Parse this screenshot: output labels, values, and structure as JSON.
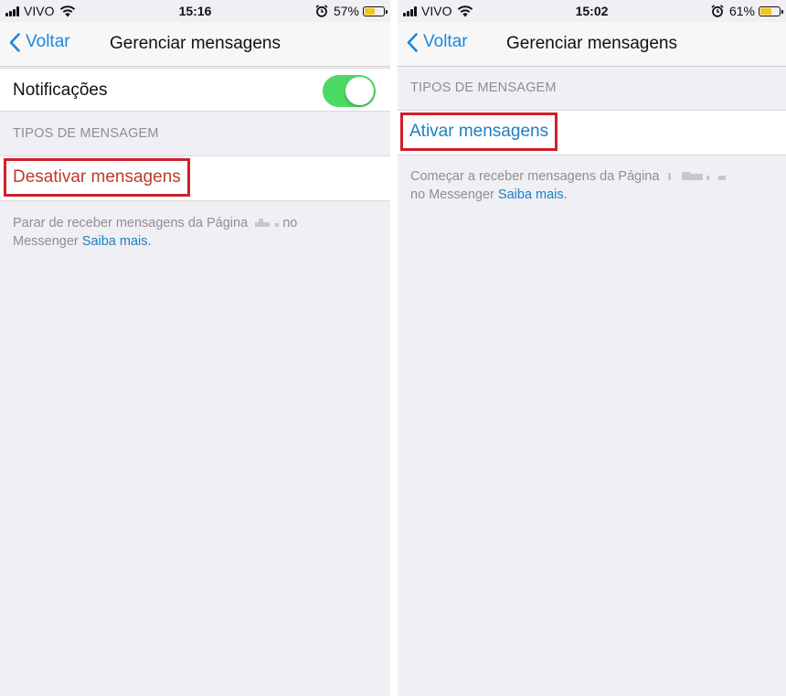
{
  "left": {
    "status": {
      "carrier": "VIVO",
      "time": "15:16",
      "battery": "57%",
      "battery_level": 0.57
    },
    "nav": {
      "back": "Voltar",
      "title": "Gerenciar mensagens"
    },
    "notifications": {
      "label": "Notificações",
      "enabled": true
    },
    "section_header": "TIPOS DE MENSAGEM",
    "action": "Desativar mensagens",
    "footer": {
      "text_before": "Parar de receber mensagens da Página",
      "text_after": "no",
      "text_line2": "Messenger",
      "link": "Saiba mais."
    }
  },
  "right": {
    "status": {
      "carrier": "VIVO",
      "time": "15:02",
      "battery": "61%",
      "battery_level": 0.61
    },
    "nav": {
      "back": "Voltar",
      "title": "Gerenciar mensagens"
    },
    "section_header": "TIPOS DE MENSAGEM",
    "action": "Ativar mensagens",
    "footer": {
      "text_before": "Começar a receber mensagens da Página",
      "text_line2": "no Messenger",
      "link": "Saiba mais."
    }
  },
  "colors": {
    "ios_blue": "#1a88e0",
    "toggle_green": "#4cd964",
    "highlight_red": "#d0202a",
    "grouped_background": "#efeff4"
  },
  "icons": [
    "signal-icon",
    "wifi-icon",
    "alarm-icon",
    "battery-icon",
    "chevron-left-icon"
  ]
}
